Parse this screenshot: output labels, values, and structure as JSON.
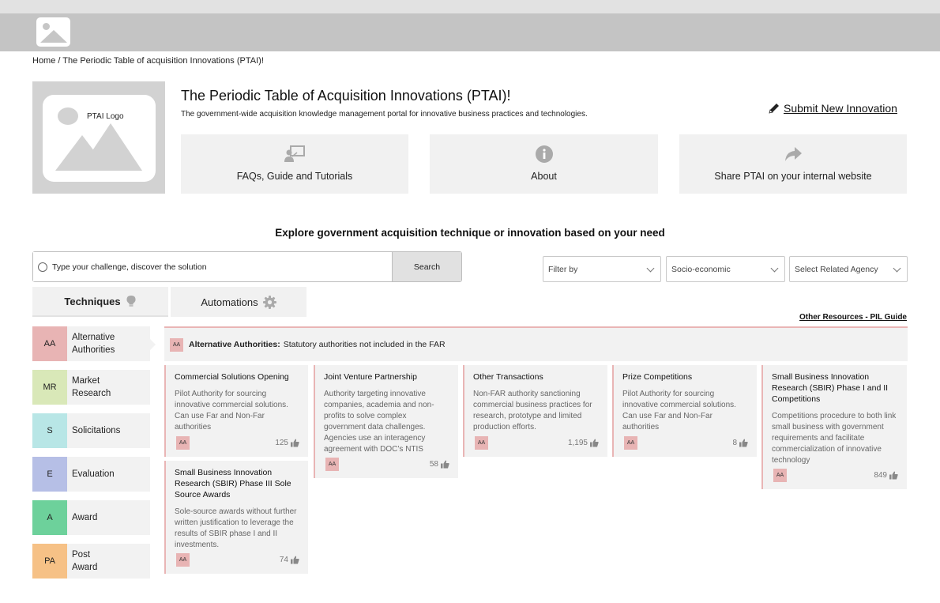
{
  "breadcrumb": "Home / The Periodic Table of acquisition Innovations (PTAI)!",
  "logo_label": "PTAI Logo",
  "title": "The Periodic Table of Acquisition Innovations (PTAI)!",
  "subtitle": "The government-wide acquisition knowledge management portal for innovative business practices and technologies.",
  "submit_link": "Submit New Innovation",
  "tiles": [
    {
      "label": "FAQs, Guide and Tutorials",
      "icon": "presenter-icon"
    },
    {
      "label": "About",
      "icon": "info-icon"
    },
    {
      "label": "Share PTAI on your internal website",
      "icon": "share-icon"
    }
  ],
  "explore_heading": "Explore government acquisition technique or innovation based on your need",
  "search": {
    "placeholder": "Type your challenge, discover the solution",
    "button": "Search"
  },
  "filters": [
    "Filter by",
    "Socio-economic",
    "Select Related Agency"
  ],
  "tabs": [
    {
      "label": "Techniques",
      "icon": "lightbulb-icon",
      "active": true
    },
    {
      "label": "Automations",
      "icon": "gear-icon",
      "active": false
    }
  ],
  "other_resources": "Other Resources - PIL Guide",
  "categories": [
    {
      "sym": "AA",
      "name": "Alternative Authorities",
      "color": "#e8b4b4"
    },
    {
      "sym": "MR",
      "name": "Market Research",
      "color": "#d9e8b8"
    },
    {
      "sym": "S",
      "name": "Solicitations",
      "color": "#b8e6e6"
    },
    {
      "sym": "E",
      "name": "Evaluation",
      "color": "#b6bfe6"
    },
    {
      "sym": "A",
      "name": "Award",
      "color": "#6dd19b"
    },
    {
      "sym": "PA",
      "name": "Post Award",
      "color": "#f6c186"
    }
  ],
  "banner": {
    "badge": "AA",
    "title": "Alternative Authorities:",
    "text": "Statutory authorities not included in the FAR"
  },
  "cards": [
    {
      "title": "Commercial Solutions Opening",
      "desc": "Pilot Authority for sourcing innovative commercial solutions. Can use Far and Non-Far authorities",
      "badge": "AA",
      "likes": "125"
    },
    {
      "title": "Joint Venture Partnership",
      "desc": "Authority targeting innovative companies, academia and non-profits to solve complex government data challenges. Agencies use an interagency agreement with DOC’s NTIS",
      "badge": "AA",
      "likes": "58"
    },
    {
      "title": "Other Transactions",
      "desc": "Non-FAR authority sanctioning commercial business practices for research, prototype and limited production efforts.",
      "badge": "AA",
      "likes": "1,195"
    },
    {
      "title": "Prize Competitions",
      "desc": "Pilot Authority for sourcing innovative commercial solutions. Can use Far and Non-Far authorities",
      "badge": "AA",
      "likes": "8"
    },
    {
      "title": "Small Business Innovation Research (SBIR) Phase I and II Competitions",
      "desc": "Competitions procedure to both link small business with government requirements and facilitate commercialization of innovative technology",
      "badge": "AA",
      "likes": "849"
    },
    {
      "title": "Small Business Innovation Research (SBIR) Phase III Sole Source Awards",
      "desc": "Sole-source awards without further written justification to leverage the results of SBIR phase I and II investments.",
      "badge": "AA",
      "likes": "74"
    }
  ]
}
